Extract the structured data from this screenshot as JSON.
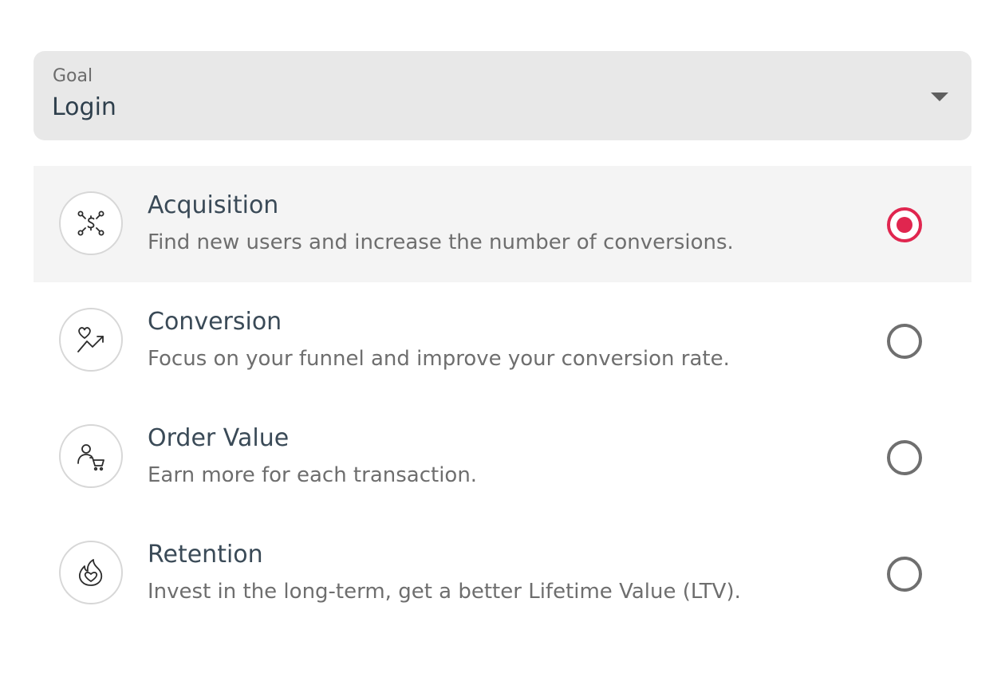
{
  "goal_select": {
    "label": "Goal",
    "value": "Login",
    "caret_icon": "caret-down-icon"
  },
  "colors": {
    "accent": "#e0264f",
    "select_bg": "#e8e8e8",
    "selected_row_bg": "#f4f4f4",
    "title_text": "#3a4a57",
    "desc_text": "#6e6e6e"
  },
  "options": [
    {
      "title": "Acquisition",
      "description": "Find new users and increase the number of conversions.",
      "icon": "network-dollar-icon",
      "selected": true
    },
    {
      "title": "Conversion",
      "description": "Focus on your funnel and improve your conversion rate.",
      "icon": "heart-trend-icon",
      "selected": false
    },
    {
      "title": "Order Value",
      "description": "Earn more for each transaction.",
      "icon": "user-cart-icon",
      "selected": false
    },
    {
      "title": "Retention",
      "description": "Invest in the long-term, get a better Lifetime Value (LTV).",
      "icon": "flame-heart-icon",
      "selected": false
    }
  ]
}
